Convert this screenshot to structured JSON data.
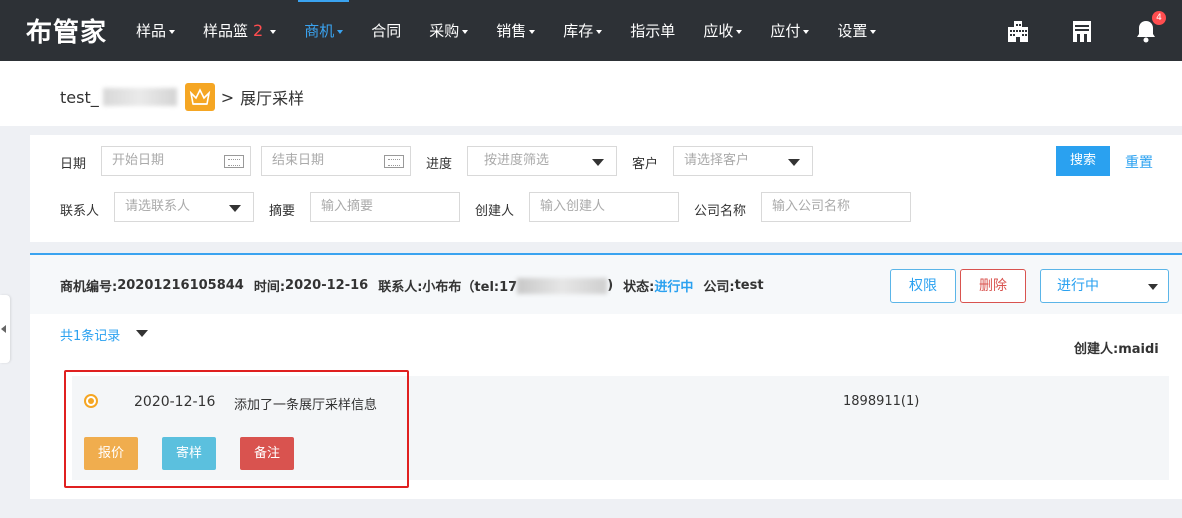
{
  "logo": "布管家",
  "nav": {
    "items": [
      {
        "label": "样品",
        "dropdown": true
      },
      {
        "label": "样品篮",
        "badge": "2",
        "dropdown": true
      },
      {
        "label": "商机",
        "dropdown": true,
        "active": true
      },
      {
        "label": "合同",
        "dropdown": false
      },
      {
        "label": "采购",
        "dropdown": true
      },
      {
        "label": "销售",
        "dropdown": true
      },
      {
        "label": "库存",
        "dropdown": true
      },
      {
        "label": "指示单",
        "dropdown": false
      },
      {
        "label": "应收",
        "dropdown": true
      },
      {
        "label": "应付",
        "dropdown": true
      },
      {
        "label": "设置",
        "dropdown": true
      }
    ],
    "notification_count": "4",
    "icons": [
      "building-icon",
      "store-icon",
      "bell-icon"
    ]
  },
  "breadcrumb": {
    "company": "test_",
    "separator": ">",
    "page": "展厅采样"
  },
  "filter": {
    "date_label": "日期",
    "start_date_placeholder": "开始日期",
    "end_date_placeholder": "结束日期",
    "progress_label": "进度",
    "progress_placeholder": "按进度筛选",
    "customer_label": "客户",
    "customer_placeholder": "请选择客户",
    "search_button": "搜索",
    "reset_link": "重置",
    "contact_label": "联系人",
    "contact_placeholder": "请选联系人",
    "summary_label": "摘要",
    "summary_placeholder": "输入摘要",
    "creator_label": "创建人",
    "creator_placeholder": "输入创建人",
    "company_label": "公司名称",
    "company_placeholder": "输入公司名称"
  },
  "record": {
    "id_label": "商机编号:",
    "id_value": "20201216105844",
    "time_label": "时间:",
    "time_value": "2020-12-16",
    "contact_label": "联系人:",
    "contact_value": "小布布（tel:17",
    "contact_close": ")",
    "status_label": "状态:",
    "status_value": "进行中",
    "company_label": "公司:",
    "company_value": "test",
    "perm_button": "权限",
    "delete_button": "删除",
    "status_select": "进行中",
    "count_text": "共1条记录",
    "creator_label": "创建人:",
    "creator_value": "maidi",
    "items": [
      {
        "date": "2020-12-16",
        "description": "添加了一条展厅采样信息",
        "code": "1898911(1)",
        "actions": [
          "报价",
          "寄样",
          "备注"
        ]
      }
    ]
  },
  "colors": {
    "topbar": "#2d3136",
    "accent": "#2aa1f0",
    "danger": "#d9534f",
    "warning": "#f0ad4e",
    "info": "#5bc0de"
  }
}
